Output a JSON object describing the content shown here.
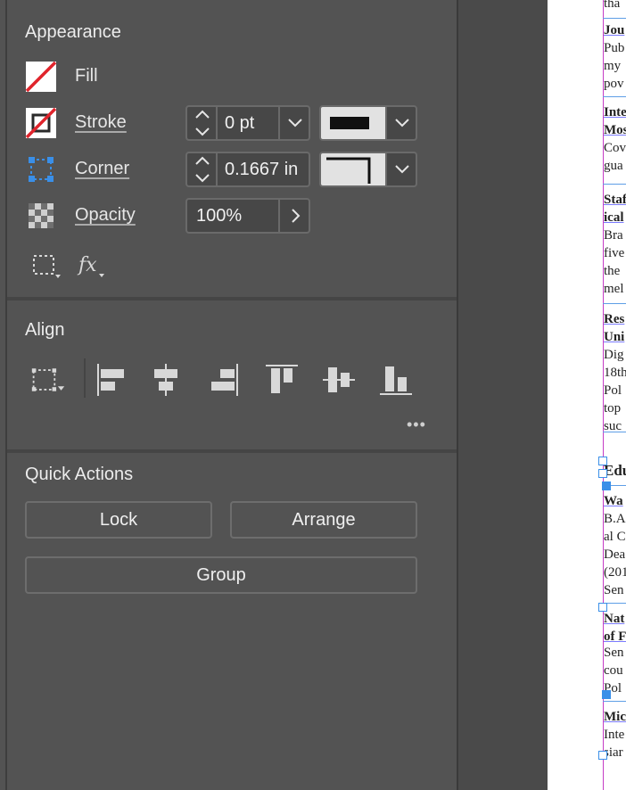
{
  "appearance": {
    "title": "Appearance",
    "fill_label": "Fill",
    "stroke_label": "Stroke",
    "stroke_weight": "0 pt",
    "corner_label": "Corner",
    "corner_size": "0.1667 in",
    "opacity_label": "Opacity",
    "opacity_value": "100%"
  },
  "align": {
    "title": "Align",
    "more": "•••"
  },
  "quick_actions": {
    "title": "Quick Actions",
    "lock": "Lock",
    "arrange": "Arrange",
    "group": "Group"
  },
  "document": {
    "lines": [
      {
        "text": "tha",
        "style": "plain"
      },
      {
        "text": "Jou",
        "style": "bold"
      },
      {
        "text": "Pub",
        "style": "plain"
      },
      {
        "text": "my",
        "style": "plain"
      },
      {
        "text": "pov",
        "style": "plain"
      },
      {
        "text": "Inte",
        "style": "bold"
      },
      {
        "text": "Mos",
        "style": "bold"
      },
      {
        "text": "Cov",
        "style": "plain"
      },
      {
        "text": "gua",
        "style": "plain"
      },
      {
        "text": "Staf",
        "style": "bold"
      },
      {
        "text": "ical",
        "style": "bold"
      },
      {
        "text": "Bra",
        "style": "plain"
      },
      {
        "text": "five",
        "style": "plain"
      },
      {
        "text": "the",
        "style": "plain"
      },
      {
        "text": "mel",
        "style": "plain"
      },
      {
        "text": "Res",
        "style": "bold"
      },
      {
        "text": "Uni",
        "style": "bold"
      },
      {
        "text": "Dig",
        "style": "plain"
      },
      {
        "text": "18th",
        "style": "plain"
      },
      {
        "text": "Pol",
        "style": "plain"
      },
      {
        "text": "top",
        "style": "plain"
      },
      {
        "text": "suc",
        "style": "plain"
      },
      {
        "text": "Edu",
        "style": "heading"
      },
      {
        "text": "Wa",
        "style": "bold"
      },
      {
        "text": "B.A",
        "style": "plain"
      },
      {
        "text": "al C",
        "style": "plain"
      },
      {
        "text": "Dea",
        "style": "plain"
      },
      {
        "text": "(201",
        "style": "plain"
      },
      {
        "text": "Sen",
        "style": "plain"
      },
      {
        "text": "Nat",
        "style": "bold"
      },
      {
        "text": "of F",
        "style": "bold"
      },
      {
        "text": "Sen",
        "style": "plain"
      },
      {
        "text": "cou",
        "style": "plain"
      },
      {
        "text": "Pol",
        "style": "plain"
      },
      {
        "text": "Mic",
        "style": "bold"
      },
      {
        "text": "Inte",
        "style": "plain"
      },
      {
        "text": "siar",
        "style": "plain"
      }
    ]
  },
  "colors": {
    "panel": "#535353",
    "field": "#474747",
    "accent_handle": "#3a8fe8",
    "margin_guide": "#c63cc6",
    "none_swatch_red": "#e0242c"
  }
}
